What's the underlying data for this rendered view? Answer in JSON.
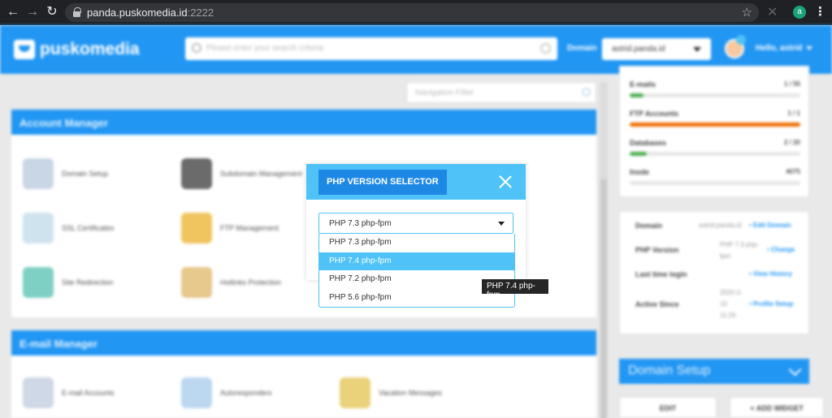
{
  "browser": {
    "url_host": "panda.puskomedia.id",
    "url_port": ":2222",
    "profile_initial": "a"
  },
  "topbar": {
    "logo": "puskomedia",
    "search_placeholder": "Please enter your search criteria",
    "domain_label": "Domain",
    "domain_value": "astrid.panda.id",
    "greeting": "Hello, astrid"
  },
  "nav_filter_placeholder": "Navigation Filter",
  "account_manager": {
    "title": "Account Manager",
    "items": [
      "Domain Setup",
      "Subdomain Management",
      "SSL Certificates",
      "FTP Management",
      "Site Redirection",
      "Hotlinks Protection"
    ]
  },
  "email_manager": {
    "title": "E-mail Manager",
    "items": [
      "E-mail Accounts",
      "Autoresponders",
      "Vacation Messages"
    ]
  },
  "stats": [
    {
      "name": "E-mails",
      "count": "1 / 55",
      "percent": 8,
      "color": "#4caf50"
    },
    {
      "name": "FTP Accounts",
      "count": "1 / 1",
      "percent": 100,
      "color": "#ef6c00"
    },
    {
      "name": "Databases",
      "count": "2 / 20",
      "percent": 10,
      "color": "#4caf50"
    },
    {
      "name": "Inode",
      "count": "4075",
      "percent": 0,
      "color": "#4caf50"
    }
  ],
  "info": {
    "domain_label": "Domain",
    "domain_value": "astrid.panda.id",
    "edit_domain": "• Edit Domain",
    "php_label": "PHP Version",
    "php_value": "PHP 7.3 php-fpm",
    "change": "• Change",
    "login_label": "Last time login",
    "view_history": "• View History",
    "active_label": "Active Since",
    "active_value": "2020-2-10 11:26",
    "profile_setup": "• Profile Setup"
  },
  "domain_setup_header": "Domain Setup",
  "buttons": {
    "edit": "EDIT",
    "add_widget": "+ ADD WIDGET"
  },
  "modal": {
    "title": "PHP VERSION SELECTOR",
    "selected": "PHP 7.3 php-fpm",
    "options": [
      "PHP 7.3 php-fpm",
      "PHP 7.4 php-fpm",
      "PHP 7.2 php-fpm",
      "PHP 5.6 php-fpm"
    ],
    "highlighted_index": 1,
    "tooltip": "PHP 7.4 php-fpm"
  }
}
